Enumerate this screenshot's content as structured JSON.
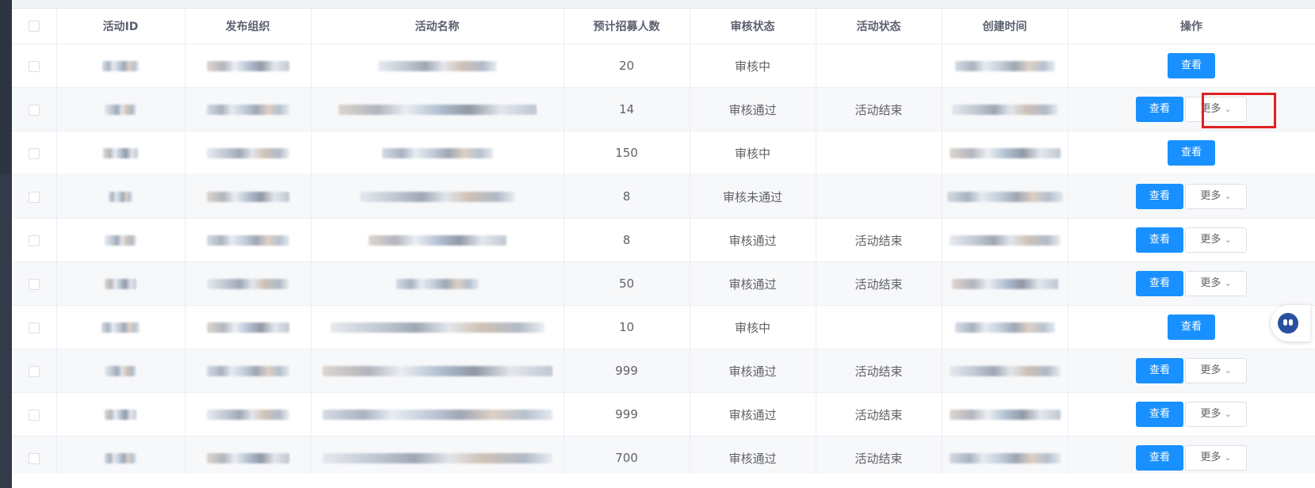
{
  "table": {
    "headers": [
      "活动ID",
      "发布组织",
      "活动名称",
      "预计招募人数",
      "审核状态",
      "活动状态",
      "创建时间",
      "操作"
    ],
    "rows": [
      {
        "recruit": "20",
        "review": "审核中",
        "status": "",
        "view": "查看",
        "more": ""
      },
      {
        "recruit": "14",
        "review": "审核通过",
        "status": "活动结束",
        "view": "查看",
        "more": "更多"
      },
      {
        "recruit": "150",
        "review": "审核中",
        "status": "",
        "view": "查看",
        "more": ""
      },
      {
        "recruit": "8",
        "review": "审核未通过",
        "status": "",
        "view": "查看",
        "more": "更多"
      },
      {
        "recruit": "8",
        "review": "审核通过",
        "status": "活动结束",
        "view": "查看",
        "more": "更多"
      },
      {
        "recruit": "50",
        "review": "审核通过",
        "status": "活动结束",
        "view": "查看",
        "more": "更多"
      },
      {
        "recruit": "10",
        "review": "审核中",
        "status": "",
        "view": "查看",
        "more": ""
      },
      {
        "recruit": "999",
        "review": "审核通过",
        "status": "活动结束",
        "view": "查看",
        "more": "更多"
      },
      {
        "recruit": "999",
        "review": "审核通过",
        "status": "活动结束",
        "view": "查看",
        "more": "更多"
      },
      {
        "recruit": "700",
        "review": "审核通过",
        "status": "活动结束",
        "view": "查看",
        "more": "更多"
      }
    ]
  },
  "icons": {
    "more_chevron": "chevron-down-icon",
    "assistant": "assistant-bot-icon",
    "checkbox": "checkbox-icon"
  },
  "colors": {
    "primary_button": "#1890ff",
    "highlight_box": "#e02020"
  }
}
